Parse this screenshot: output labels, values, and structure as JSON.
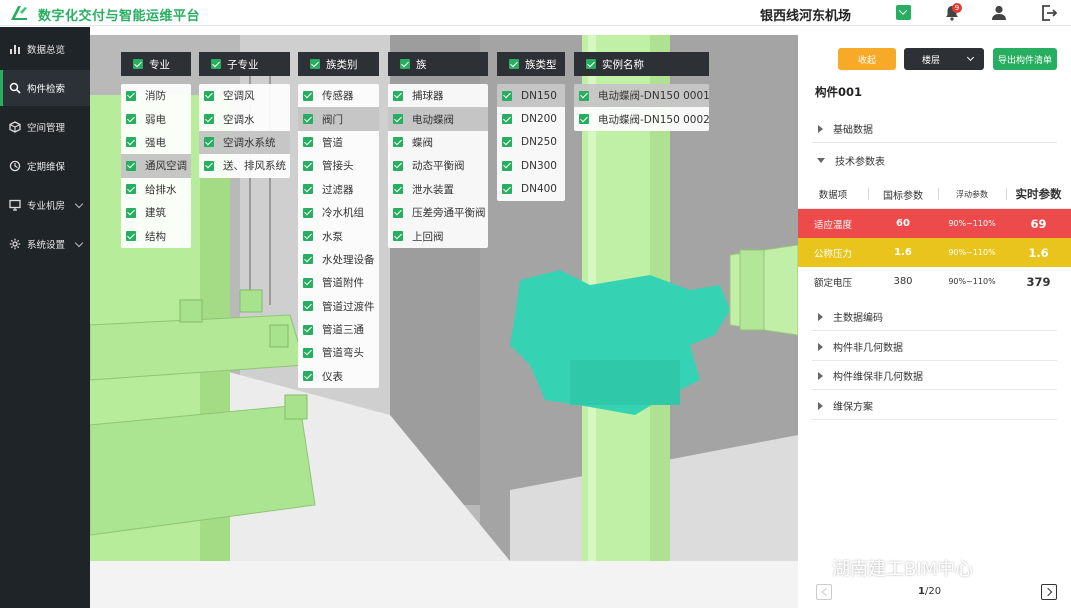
{
  "header": {
    "title": "数字化交付与智能运维平台",
    "site": "银西线河东机场",
    "notification_count": "9",
    "colors": {
      "accent": "#27ae60",
      "badge": "#e53935"
    }
  },
  "sidebar": {
    "items": [
      {
        "label": "数据总览",
        "icon": "bar-chart-icon"
      },
      {
        "label": "构件检索",
        "icon": "search-icon"
      },
      {
        "label": "空间管理",
        "icon": "cube-icon"
      },
      {
        "label": "定期维保",
        "icon": "clock-icon"
      },
      {
        "label": "专业机房",
        "icon": "monitor-icon"
      },
      {
        "label": "系统设置",
        "icon": "gear-icon"
      }
    ],
    "active": "构件检索"
  },
  "filters": {
    "columns": [
      {
        "header": "专业",
        "items": [
          "消防",
          "弱电",
          "强电",
          "通风空调",
          "给排水",
          "建筑",
          "结构"
        ],
        "selected": "通风空调"
      },
      {
        "header": "子专业",
        "items": [
          "空调风",
          "空调水",
          "空调水系统",
          "送、排风系统"
        ],
        "selected": "空调水系统"
      },
      {
        "header": "族类别",
        "items": [
          "传感器",
          "阀门",
          "管道",
          "管接头",
          "过滤器",
          "冷水机组",
          "水泵",
          "水处理设备",
          "管道附件",
          "管道过渡件",
          "管道三通",
          "管道弯头",
          "仪表"
        ],
        "selected": "阀门"
      },
      {
        "header": "族",
        "items": [
          "捕球器",
          "电动蝶阀",
          "蝶阀",
          "动态平衡阀",
          "泄水装置",
          "压差旁通平衡阀",
          "上回阀"
        ],
        "selected": "电动蝶阀"
      },
      {
        "header": "族类型",
        "items": [
          "DN150",
          "DN200",
          "DN250",
          "DN300",
          "DN400"
        ],
        "selected": "DN150"
      },
      {
        "header": "实例名称",
        "items": [
          "电动蝶阀-DN150 0001",
          "电动蝶阀-DN150 0002"
        ],
        "selected": "电动蝶阀-DN150 0001"
      }
    ]
  },
  "panel": {
    "buttons": {
      "collapse": "收起",
      "floor": "楼层",
      "export": "导出构件清单"
    },
    "component_title": "构件001",
    "sections_top": [
      "基础数据",
      "技术参数表"
    ],
    "params": {
      "headers": [
        "数据项",
        "国标参数",
        "浮动参数",
        "实时参数"
      ],
      "rows": [
        {
          "name": "适应温度",
          "standard": "60",
          "range": "90%~110%",
          "realtime": "69",
          "status": "alarm"
        },
        {
          "name": "公称压力",
          "standard": "1.6",
          "range": "90%~110%",
          "realtime": "1.6",
          "status": "warning"
        },
        {
          "name": "额定电压",
          "standard": "380",
          "range": "90%~110%",
          "realtime": "379",
          "status": "normal"
        }
      ],
      "colors": {
        "alarm": "#ed4b4b",
        "warning": "#e8c41c"
      }
    },
    "sections_bottom": [
      "主数据编码",
      "构件非几何数据",
      "构件维保非几何数据",
      "维保方案"
    ],
    "pager": {
      "current": "1",
      "total": "/20"
    }
  },
  "watermark": "湖南建工BIM中心"
}
